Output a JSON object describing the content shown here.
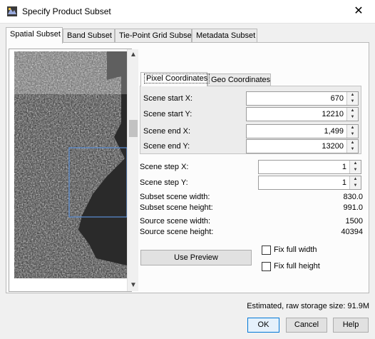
{
  "window": {
    "title": "Specify Product Subset",
    "close_symbol": "✕"
  },
  "tabs": [
    "Spatial Subset",
    "Band Subset",
    "Tie-Point Grid Subset",
    "Metadata Subset"
  ],
  "coord_tabs": [
    "Pixel Coordinates",
    "Geo Coordinates"
  ],
  "pixel_coords": [
    {
      "label": "Scene start X:",
      "value": "670"
    },
    {
      "label": "Scene start Y:",
      "value": "12210"
    },
    {
      "label": "Scene end X:",
      "value": "1,499"
    },
    {
      "label": "Scene end Y:",
      "value": "13200"
    }
  ],
  "steps": [
    {
      "label": "Scene step X:",
      "value": "1"
    },
    {
      "label": "Scene step Y:",
      "value": "1"
    }
  ],
  "info": [
    {
      "label": "Subset scene width:",
      "value": "830.0"
    },
    {
      "label": "Subset scene height:",
      "value": "991.0"
    },
    {
      "label": "Source scene width:",
      "value": "1500"
    },
    {
      "label": "Source scene height:",
      "value": "40394"
    }
  ],
  "use_preview_label": "Use Preview",
  "fix_full_width_label": "Fix full width",
  "fix_full_height_label": "Fix full height",
  "storage_text": "Estimated, raw storage size: 91.9M",
  "buttons": {
    "ok": "OK",
    "cancel": "Cancel",
    "help": "Help"
  },
  "colors": {
    "accent": "#0078d7",
    "selection_rect": "#5b8fd6"
  }
}
